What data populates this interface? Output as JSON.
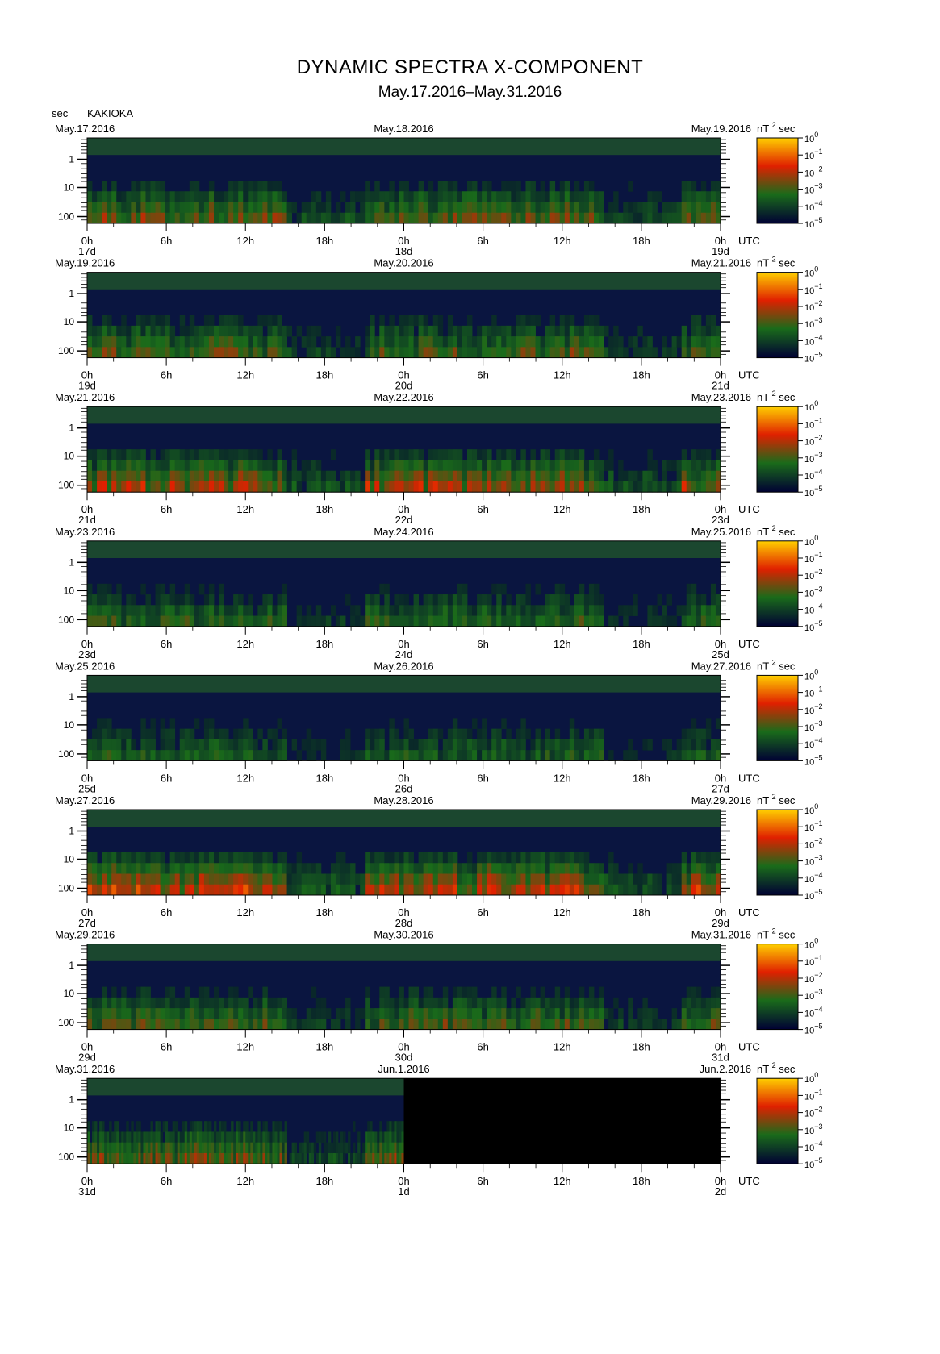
{
  "title": "DYNAMIC SPECTRA X-COMPONENT",
  "subtitle": "May.17.2016–May.31.2016",
  "y_unit": "sec",
  "station": "KAKIOKA",
  "colorbar_unit": "nT",
  "colorbar_unit_exp": "2",
  "colorbar_unit_tail": "sec",
  "colorbar_ticks": [
    {
      "base": "10",
      "exp": "0"
    },
    {
      "base": "10",
      "exp": "−1"
    },
    {
      "base": "10",
      "exp": "−2"
    },
    {
      "base": "10",
      "exp": "−3"
    },
    {
      "base": "10",
      "exp": "−4"
    },
    {
      "base": "10",
      "exp": "−5"
    }
  ],
  "colors": {
    "spectrum_low": "#000033",
    "spectrum_mid": "#1a6b1a",
    "spectrum_high": "#e02000",
    "spectrum_peak": "#ffd000",
    "no_data": "#000000"
  },
  "chart_data": {
    "type": "heatmap",
    "x_ticks": [
      "0h",
      "6h",
      "12h",
      "18h",
      "0h",
      "6h",
      "12h",
      "18h",
      "0h"
    ],
    "x_unit": "UTC",
    "y_ticks": [
      "1",
      "10",
      "100"
    ],
    "y_scale": "log",
    "color_scale": "log",
    "color_range": [
      1e-05,
      1
    ],
    "panels": [
      {
        "left_date": "May.17.2016",
        "mid_date": "May.18.2016",
        "right_date": "May.19.2016",
        "day_labels": [
          "17d",
          "18d",
          "19d"
        ],
        "data_fraction": 1.0,
        "activity": 0.55
      },
      {
        "left_date": "May.19.2016",
        "mid_date": "May.20.2016",
        "right_date": "May.21.2016",
        "day_labels": [
          "19d",
          "20d",
          "21d"
        ],
        "data_fraction": 1.0,
        "activity": 0.5
      },
      {
        "left_date": "May.21.2016",
        "mid_date": "May.22.2016",
        "right_date": "May.23.2016",
        "day_labels": [
          "21d",
          "22d",
          "23d"
        ],
        "data_fraction": 1.0,
        "activity": 0.65
      },
      {
        "left_date": "May.23.2016",
        "mid_date": "May.24.2016",
        "right_date": "May.25.2016",
        "day_labels": [
          "23d",
          "24d",
          "25d"
        ],
        "data_fraction": 1.0,
        "activity": 0.4
      },
      {
        "left_date": "May.25.2016",
        "mid_date": "May.26.2016",
        "right_date": "May.27.2016",
        "day_labels": [
          "25d",
          "26d",
          "27d"
        ],
        "data_fraction": 1.0,
        "activity": 0.35
      },
      {
        "left_date": "May.27.2016",
        "mid_date": "May.28.2016",
        "right_date": "May.29.2016",
        "day_labels": [
          "27d",
          "28d",
          "29d"
        ],
        "data_fraction": 1.0,
        "activity": 0.75
      },
      {
        "left_date": "May.29.2016",
        "mid_date": "May.30.2016",
        "right_date": "May.31.2016",
        "day_labels": [
          "29d",
          "30d",
          "31d"
        ],
        "data_fraction": 1.0,
        "activity": 0.5
      },
      {
        "left_date": "May.31.2016",
        "mid_date": "Jun.1.2016",
        "right_date": "Jun.2.2016",
        "day_labels": [
          "31d",
          "1d",
          "2d"
        ],
        "data_fraction": 0.5,
        "activity": 0.55
      }
    ]
  }
}
